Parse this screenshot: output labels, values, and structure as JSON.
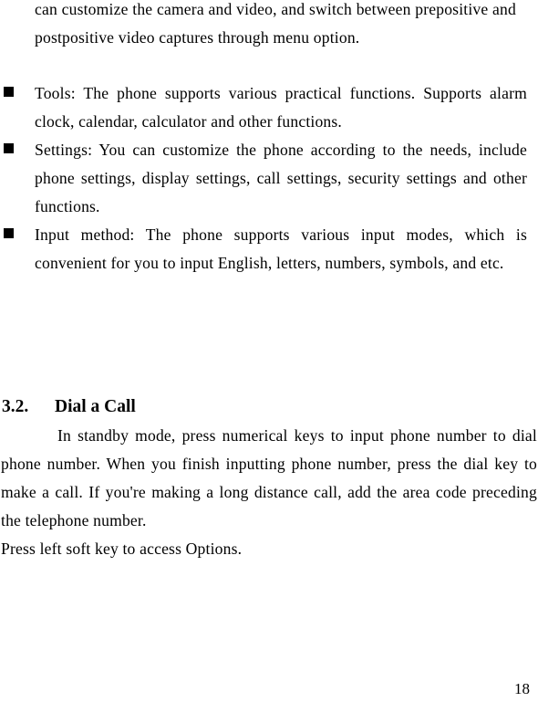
{
  "document": {
    "section_heading": {
      "number": "3.2.",
      "title": "Dial a Call"
    },
    "continued_paragraph": "can customize the camera and video, and switch between prepositive and postpositive video captures through menu option.",
    "bullet_items": [
      {
        "marker": "black-square",
        "text": "Tools: The phone supports various practical functions. Supports alarm clock, calendar, calculator and other functions."
      },
      {
        "marker": "black-square",
        "text": "Settings: You can customize the phone according to the needs, include phone settings, display settings, call settings, security settings and other functions."
      },
      {
        "marker": "black-square",
        "text": "Input method: The phone supports various input modes, which is convenient for you to input English, letters, numbers, symbols, and etc."
      }
    ],
    "body_paragraph_main": "In standby mode, press numerical keys to input phone number to dial phone number. When you finish inputting phone number, press the dial key to make a call. If you're making a long distance call, add the area code preceding the telephone number.",
    "body_paragraph_tail": "Press left soft key to access Options.",
    "page_number": "18"
  }
}
